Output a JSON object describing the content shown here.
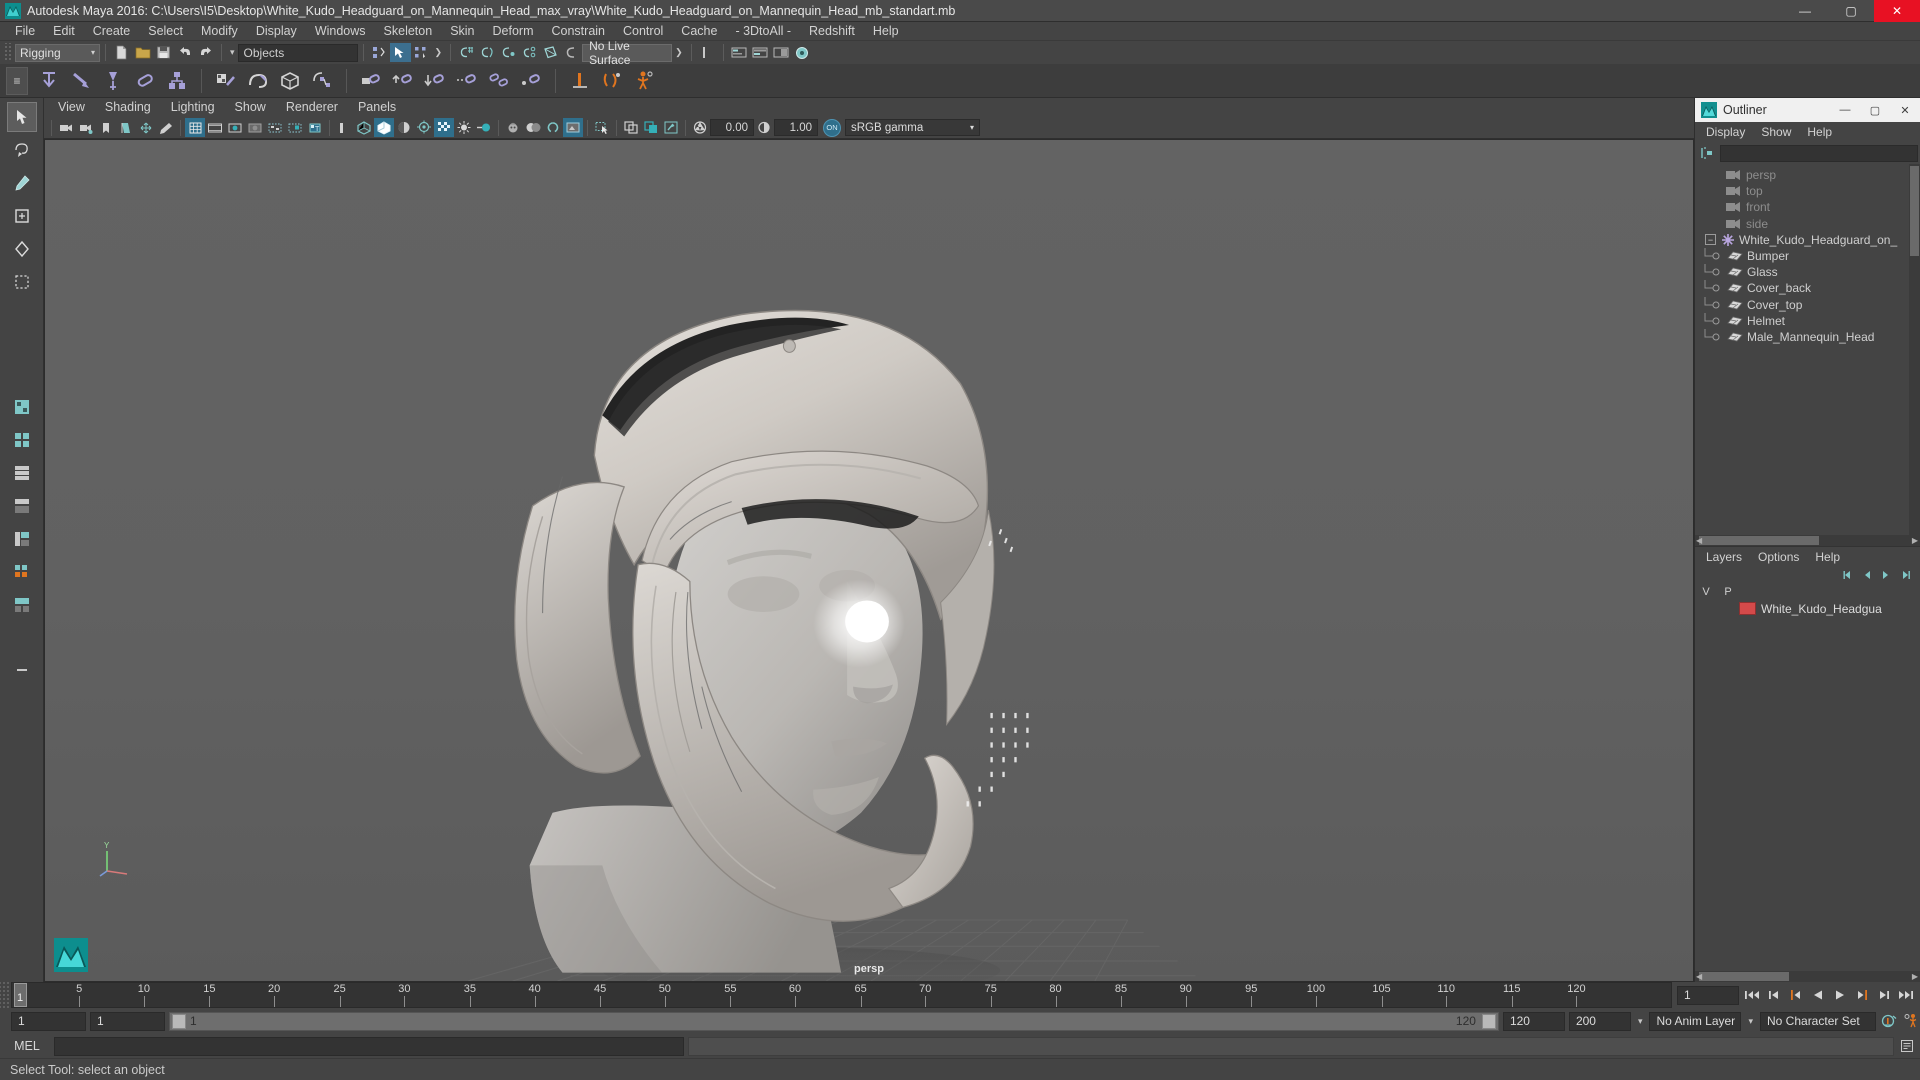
{
  "window": {
    "title": "Autodesk Maya 2016: C:\\Users\\I5\\Desktop\\White_Kudo_Headguard_on_Mannequin_Head_max_vray\\White_Kudo_Headguard_on_Mannequin_Head_mb_standart.mb",
    "app_icon": "maya-icon",
    "minimize": "—",
    "maximize": "▢",
    "close": "✕"
  },
  "menubar": {
    "items": [
      "File",
      "Edit",
      "Create",
      "Select",
      "Modify",
      "Display",
      "Windows",
      "Skeleton",
      "Skin",
      "Deform",
      "Constrain",
      "Control",
      "Cache",
      "- 3DtoAll -",
      "Redshift",
      "Help"
    ]
  },
  "statusline": {
    "menuset": "Rigging",
    "menuset_arrow": "▾",
    "selection_mask_arrow": "▾",
    "selection_mask": "Objects",
    "live_surface": "No Live Surface",
    "icons": [
      "new-scene-icon",
      "open-scene-icon",
      "save-scene-icon",
      "undo-icon",
      "redo-icon",
      "select-hierarchy-icon",
      "select-object-icon",
      "select-component-icon",
      "snap-grid-icon",
      "snap-curve-icon",
      "snap-point-icon",
      "snap-projected-icon",
      "snap-view-plane-icon",
      "make-live-icon",
      "show-editor-icon",
      "attribute-editor-icon",
      "tool-settings-icon",
      "channel-box-icon"
    ]
  },
  "shelf": {
    "tab_icon": "shelf-tabs-icon",
    "icons": [
      "create-joint-icon",
      "ik-handle-icon",
      "ik-spline-icon",
      "constraint-icon",
      "create-skeleton-icon",
      "bind-skin-icon",
      "paint-weights-icon",
      "lattice-icon",
      "wrap-deformer-icon",
      "parent-constraint-icon",
      "point-constraint-icon",
      "orient-constraint-icon",
      "scale-constraint-icon",
      "aim-constraint-icon",
      "pole-vector-icon",
      "set-key-icon",
      "character-set-icon",
      "quick-rig-icon",
      "hik-icon"
    ]
  },
  "toolbox": {
    "items": [
      "select-tool",
      "lasso-select-tool",
      "paint-select-tool",
      "move-tool",
      "rotate-tool",
      "scale-tool",
      "last-tool"
    ],
    "layouts": [
      "single-perspective-layout",
      "four-view-layout",
      "persp-outliner-layout",
      "persp-graph-layout",
      "persp-hypershade-layout",
      "two-pane-layout",
      "three-pane-layout",
      "more-layouts"
    ],
    "selected": "select-tool"
  },
  "viewport": {
    "menus": [
      "View",
      "Shading",
      "Lighting",
      "Show",
      "Renderer",
      "Panels"
    ],
    "camera_label": "persp",
    "toolbar": {
      "icons": [
        "select-camera-icon",
        "camera-attributes-icon",
        "bookmarks-icon",
        "image-plane-icon",
        "2d-pan-zoom-icon",
        "grease-pencil-icon",
        "grid-icon",
        "film-gate-icon",
        "resolution-gate-icon",
        "gate-mask-icon",
        "xray-icon",
        "xray-joints-icon",
        "xray-active-components-icon",
        "wireframe-icon",
        "smooth-shade-all-icon",
        "shade-x-ray-icon",
        "textured-icon",
        "use-all-lights-icon",
        "shadows-icon",
        "screen-space-ao-icon",
        "motion-blur-icon",
        "multisample-icon",
        "isolate-select-icon",
        "single-view-icon",
        "outliner-view-icon",
        "grab-icon",
        "exposure-icon",
        "gamma-icon"
      ],
      "exposure_value": "0.00",
      "gamma_value": "1.00",
      "color_management": "sRGB gamma",
      "color_management_arrow": "▾",
      "cm_toggle": "ON"
    }
  },
  "outliner": {
    "panel_icon": "outliner-icon",
    "title": "Outliner",
    "minimize": "—",
    "maximize": "▢",
    "close": "✕",
    "menus": [
      "Display",
      "Show",
      "Help"
    ],
    "filter_icon": "filter-icon",
    "search_value": "",
    "items": [
      {
        "label": "persp",
        "icon": "camera-icon",
        "depth": 1,
        "dim": true,
        "type": "camera"
      },
      {
        "label": "top",
        "icon": "camera-icon",
        "depth": 1,
        "dim": true,
        "type": "camera"
      },
      {
        "label": "front",
        "icon": "camera-icon",
        "depth": 1,
        "dim": true,
        "type": "camera"
      },
      {
        "label": "side",
        "icon": "camera-icon",
        "depth": 1,
        "dim": true,
        "type": "camera"
      },
      {
        "label": "White_Kudo_Headguard_on_",
        "icon": "transform-star-icon",
        "depth": 0,
        "dim": false,
        "type": "group",
        "expander": "−"
      },
      {
        "label": "Bumper",
        "icon": "mesh-icon",
        "depth": 2,
        "dim": false,
        "type": "mesh"
      },
      {
        "label": "Glass",
        "icon": "mesh-icon",
        "depth": 2,
        "dim": false,
        "type": "mesh"
      },
      {
        "label": "Cover_back",
        "icon": "mesh-icon",
        "depth": 2,
        "dim": false,
        "type": "mesh"
      },
      {
        "label": "Cover_top",
        "icon": "mesh-icon",
        "depth": 2,
        "dim": false,
        "type": "mesh"
      },
      {
        "label": "Helmet",
        "icon": "mesh-icon",
        "depth": 2,
        "dim": false,
        "type": "mesh"
      },
      {
        "label": "Male_Mannequin_Head",
        "icon": "mesh-icon",
        "depth": 2,
        "dim": false,
        "type": "mesh"
      }
    ]
  },
  "layers": {
    "tabs": [
      "Layers",
      "Options",
      "Help"
    ],
    "tool_icons": [
      "layer-first-icon",
      "layer-prev-icon",
      "layer-next-icon",
      "layer-last-icon"
    ],
    "columns": [
      "V",
      "P"
    ],
    "rows": [
      {
        "visible": "",
        "playback": "",
        "color": "#d44a4a",
        "name": "White_Kudo_Headgua"
      }
    ]
  },
  "timeline": {
    "current_frame": "1",
    "ticks": [
      5,
      10,
      15,
      20,
      25,
      30,
      35,
      40,
      45,
      50,
      55,
      60,
      65,
      70,
      75,
      80,
      85,
      90,
      95,
      100,
      105,
      110,
      115,
      120
    ],
    "frame_field": "1",
    "playback_buttons": [
      "go-to-start-icon",
      "step-back-keyframe-icon",
      "step-back-frame-icon",
      "play-backwards-icon",
      "play-forwards-icon",
      "step-forward-frame-icon",
      "step-forward-keyframe-icon",
      "go-to-end-icon"
    ]
  },
  "range": {
    "start_field": "1",
    "end_field": "1",
    "slider_start_label": "1",
    "slider_end_label": "120",
    "playback_end": "120",
    "range_end": "200",
    "anim_layer": "No Anim Layer",
    "character_set": "No Character Set",
    "anim_layer_arrow": "▾",
    "character_arrow": "▾",
    "auto_key_icon": "auto-keyframe-icon",
    "anim_prefs_icon": "animation-preferences-icon"
  },
  "command": {
    "label": "MEL",
    "input_value": "",
    "output_value": "",
    "script_editor_icon": "script-editor-icon"
  },
  "statusbar": {
    "help_text": "Select Tool: select an object"
  },
  "colors": {
    "accent_blue": "#2f6f8c",
    "panel_bg": "#444444",
    "field_bg": "#333333",
    "viewport_bg": "#616161",
    "layer_color": "#d44a4a",
    "close_red": "#e81123",
    "orange": "#e0751f"
  }
}
